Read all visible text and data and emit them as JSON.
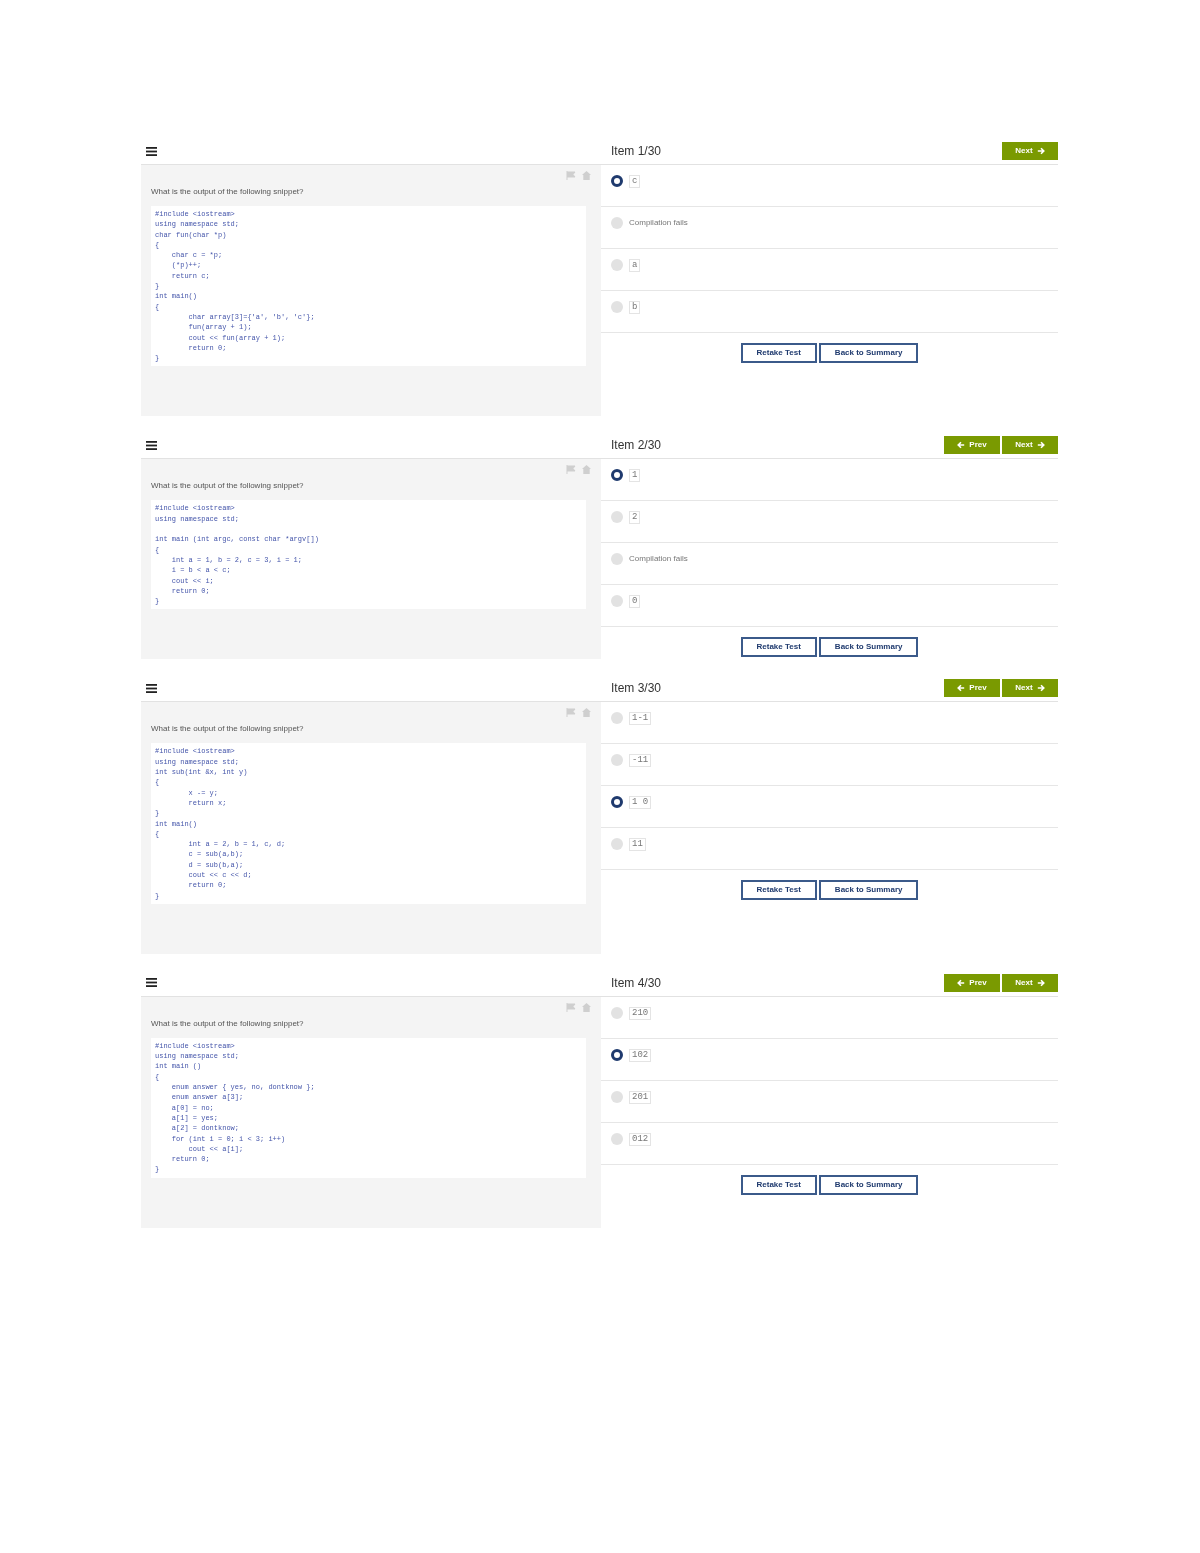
{
  "items": [
    {
      "title": "Item 1/30",
      "nav": [
        {
          "kind": "next",
          "label": "Next"
        }
      ],
      "question": "What is the output of the following snippet?",
      "code": [
        [
          "#include <iostream>",
          "using namespace std;",
          "char fun(char *p)",
          "{",
          "    char c = *p;",
          "    (*p)++;",
          "    return c;",
          "}",
          "int main()",
          "{",
          "        char array[3]={'a', 'b', 'c'};",
          "        fun(array + 1);",
          "        cout << fun(array + 1);",
          "        return 0;",
          "}"
        ]
      ],
      "options": [
        {
          "kind": "code",
          "text": "c",
          "selected": true
        },
        {
          "kind": "text",
          "text": "Compilation fails",
          "selected": false
        },
        {
          "kind": "code",
          "text": "a",
          "selected": false
        },
        {
          "kind": "code",
          "text": "b",
          "selected": false
        }
      ],
      "actions": [
        "Retake Test",
        "Back to Summary"
      ]
    },
    {
      "title": "Item 2/30",
      "nav": [
        {
          "kind": "prev",
          "label": "Prev"
        },
        {
          "kind": "next",
          "label": "Next"
        }
      ],
      "question": "What is the output of the following snippet?",
      "code": [
        [
          "#include <iostream>",
          "using namespace std;"
        ],
        [
          "int main (int argc, const char *argv[])",
          "{",
          "    int a = 1, b = 2, c = 3, i = 1;",
          "    i = b < a < c;",
          "    cout << i;",
          "    return 0;",
          "}"
        ]
      ],
      "options": [
        {
          "kind": "code",
          "text": "1",
          "selected": true
        },
        {
          "kind": "code",
          "text": "2",
          "selected": false
        },
        {
          "kind": "text",
          "text": "Compilation fails",
          "selected": false
        },
        {
          "kind": "code",
          "text": "0",
          "selected": false
        }
      ],
      "actions": [
        "Retake Test",
        "Back to Summary"
      ]
    },
    {
      "title": "Item 3/30",
      "nav": [
        {
          "kind": "prev",
          "label": "Prev"
        },
        {
          "kind": "next",
          "label": "Next"
        }
      ],
      "question": "What is the output of the following snippet?",
      "code": [
        [
          "#include <iostream>",
          "using namespace std;",
          "int sub(int &x, int y)",
          "{",
          "        x -= y;",
          "        return x;",
          "}",
          "int main()",
          "{",
          "        int a = 2, b = 1, c, d;",
          "        c = sub(a,b);",
          "        d = sub(b,a);",
          "        cout << c << d;",
          "        return 0;",
          "}"
        ]
      ],
      "options": [
        {
          "kind": "code",
          "text": "1-1",
          "selected": false
        },
        {
          "kind": "code",
          "text": "-11",
          "selected": false
        },
        {
          "kind": "code",
          "text": "1 0",
          "selected": true
        },
        {
          "kind": "code",
          "text": "11",
          "selected": false
        }
      ],
      "actions": [
        "Retake Test",
        "Back to Summary"
      ]
    },
    {
      "title": "Item 4/30",
      "nav": [
        {
          "kind": "prev",
          "label": "Prev"
        },
        {
          "kind": "next",
          "label": "Next"
        }
      ],
      "question": "What is the output of the following snippet?",
      "code": [
        [
          "#include <iostream>",
          "using namespace std;",
          "int main ()",
          "{",
          "    enum answer { yes, no, dontknow };",
          "    enum answer a[3];",
          "    a[0] = no;",
          "    a[1] = yes;",
          "    a[2] = dontknow;",
          "    for (int i = 0; i < 3; i++)",
          "        cout << a[i];",
          "    return 0;",
          "}"
        ]
      ],
      "options": [
        {
          "kind": "code",
          "text": "210",
          "selected": false
        },
        {
          "kind": "code",
          "text": "102",
          "selected": true
        },
        {
          "kind": "code",
          "text": "201",
          "selected": false
        },
        {
          "kind": "code",
          "text": "012",
          "selected": false
        }
      ],
      "actions": [
        "Retake Test",
        "Back to Summary"
      ]
    }
  ]
}
